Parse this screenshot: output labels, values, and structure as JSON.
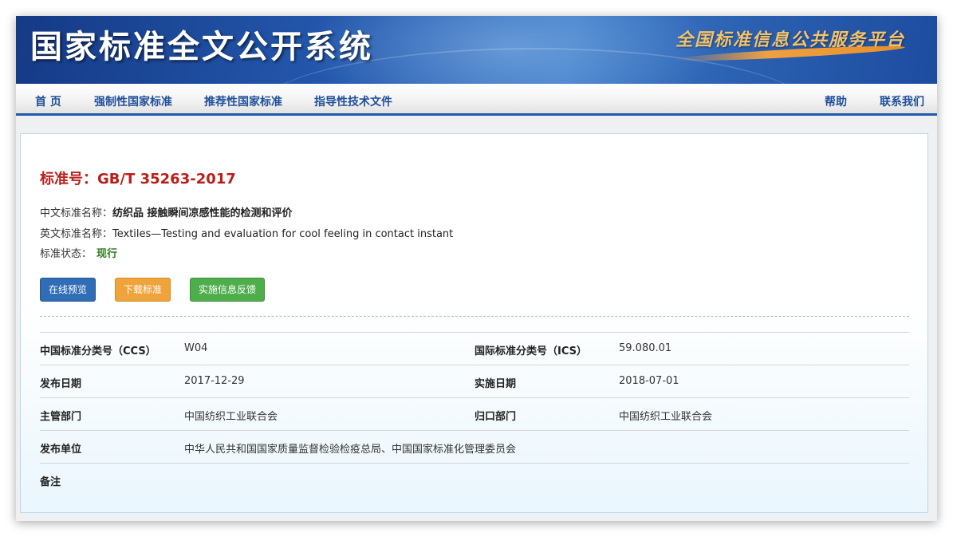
{
  "banner": {
    "site_title": "国家标准全文公开系统",
    "slogan": "全国标准信息公共服务平台"
  },
  "nav": {
    "items": [
      "首 页",
      "强制性国家标准",
      "推荐性国家标准",
      "指导性技术文件"
    ],
    "right_items": [
      "帮助",
      "联系我们"
    ]
  },
  "standard": {
    "number_label": "标准号：",
    "number": "GB/T 35263-2017",
    "cn_name_label": "中文标准名称：",
    "cn_name": "纺织品 接触瞬间凉感性能的检测和评价",
    "en_name_label": "英文标准名称：",
    "en_name": "Textiles—Testing and evaluation for cool feeling in contact instant",
    "status_label": "标准状态：",
    "status": "现行"
  },
  "actions": {
    "preview": "在线预览",
    "download": "下载标准",
    "feedback": "实施信息反馈"
  },
  "details": {
    "ccs_label": "中国标准分类号（CCS）",
    "ccs": "W04",
    "ics_label": "国际标准分类号（ICS）",
    "ics": "59.080.01",
    "publish_date_label": "发布日期",
    "publish_date": "2017-12-29",
    "impl_date_label": "实施日期",
    "impl_date": "2018-07-01",
    "dept_label": "主管部门",
    "dept": "中国纺织工业联合会",
    "owner_label": "归口部门",
    "owner": "中国纺织工业联合会",
    "publisher_label": "发布单位",
    "publisher": "中华人民共和国国家质量监督检验检疫总局、中国国家标准化管理委员会",
    "remark_label": "备注",
    "remark": ""
  },
  "colors": {
    "brand_blue": "#1f5aa8",
    "standard_number_red": "#b8201c",
    "status_green": "#2e7d1f",
    "btn_blue": "#2f6db6",
    "btn_orange": "#efa43b",
    "btn_green": "#4fae4c"
  }
}
